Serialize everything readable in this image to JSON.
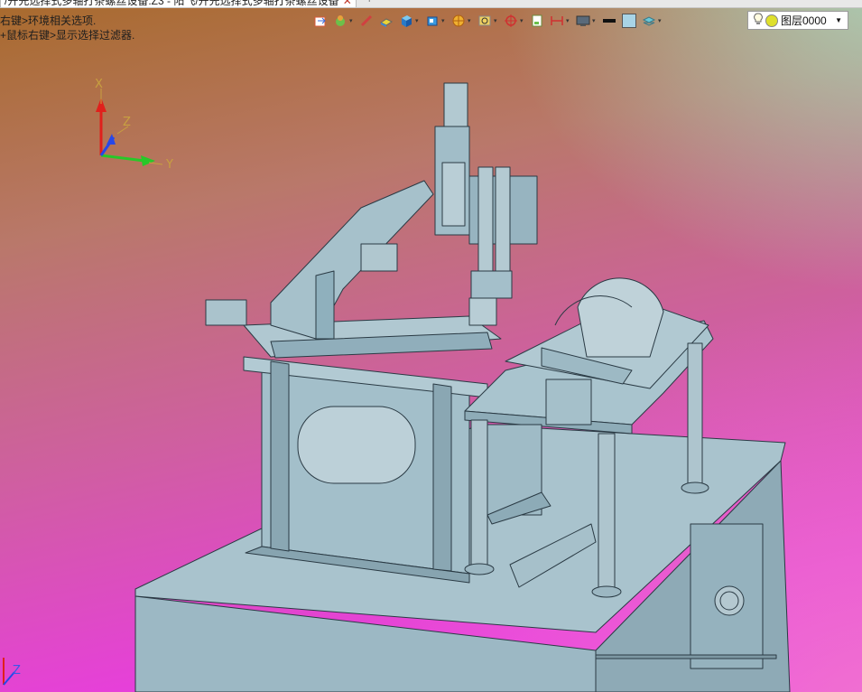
{
  "window": {
    "tab_title": "/导料尤选择式多轴打条螺丝设备.Z3 - 飞机尤选择式多轴打条螺丝设备 ×",
    "tab_title_visible": "/开先选择式多轴打条螺丝设备.Z3 - 阳飞/开先选择式多轴打条螺丝设备",
    "tab_close": "✕",
    "tab_add": "+"
  },
  "hints": {
    "line1": "右键>环境相关选项.",
    "line2": "+鼠标右键>显示选择过滤器."
  },
  "toolbar": {
    "buttons": [
      {
        "name": "view-import-icon"
      },
      {
        "name": "render-mode-icon"
      },
      {
        "name": "pen-icon"
      },
      {
        "name": "wireframe-box-icon"
      },
      {
        "name": "shaded-cube-icon"
      },
      {
        "name": "cube-dropdown-icon"
      },
      {
        "name": "section-wheel-icon"
      },
      {
        "name": "zoom-box-icon"
      },
      {
        "name": "target-icon"
      },
      {
        "name": "page-icon"
      },
      {
        "name": "dimension-icon"
      },
      {
        "name": "monitor-icon"
      },
      {
        "name": "line-color-icon"
      },
      {
        "name": "fill-color-icon"
      },
      {
        "name": "layers-icon"
      }
    ],
    "line_color": "#111111",
    "fill_color": "#a8d4e6"
  },
  "layer": {
    "value": "图层0000",
    "color": "#dfe02c"
  },
  "axes": {
    "x_label": "X",
    "y_label": "Y",
    "z_label": "Z",
    "corner_z_label": "Z"
  },
  "colors": {
    "model_face": "#9fbcc8",
    "model_edge": "#2a3a44",
    "axis_red": "#e0201c",
    "axis_green": "#28c828",
    "axis_blue": "#2848e8"
  }
}
